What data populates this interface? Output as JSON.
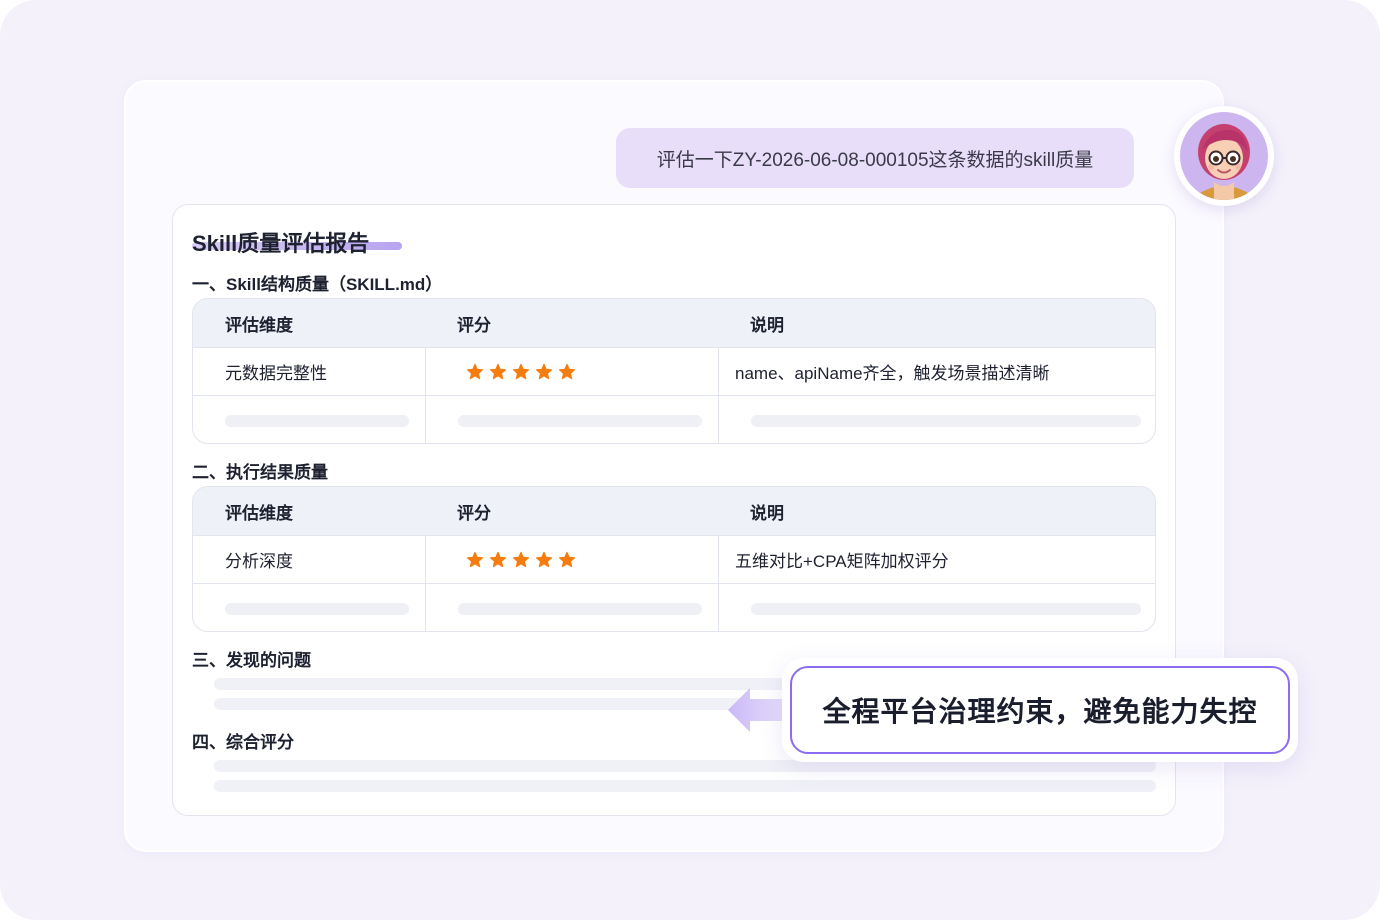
{
  "user_message": "评估一下ZY-2026-06-08-000105这条数据的skill质量",
  "report": {
    "title": "Skill质量评估报告",
    "section1": {
      "heading": "一、Skill结构质量（SKILL.md）",
      "columns": [
        "评估维度",
        "评分",
        "说明"
      ],
      "rows": [
        {
          "dimension": "元数据完整性",
          "rating": 5,
          "note": "name、apiName齐全，触发场景描述清晰"
        }
      ]
    },
    "section2": {
      "heading": "二、执行结果质量",
      "columns": [
        "评估维度",
        "评分",
        "说明"
      ],
      "rows": [
        {
          "dimension": "分析深度",
          "rating": 5,
          "note": "五维对比+CPA矩阵加权评分"
        }
      ]
    },
    "section3": {
      "heading": "三、发现的问题"
    },
    "section4": {
      "heading": "四、综合评分"
    }
  },
  "callout": {
    "text": "全程平台治理约束，避免能力失控"
  },
  "colors": {
    "accent": "#8b6cf0",
    "bubble": "#e9defa",
    "star": "#f57c0e",
    "table_header": "#eef1f8"
  },
  "icons": {
    "avatar": "user-avatar",
    "rating": "star-icon",
    "pointer": "arrow-left-icon"
  }
}
